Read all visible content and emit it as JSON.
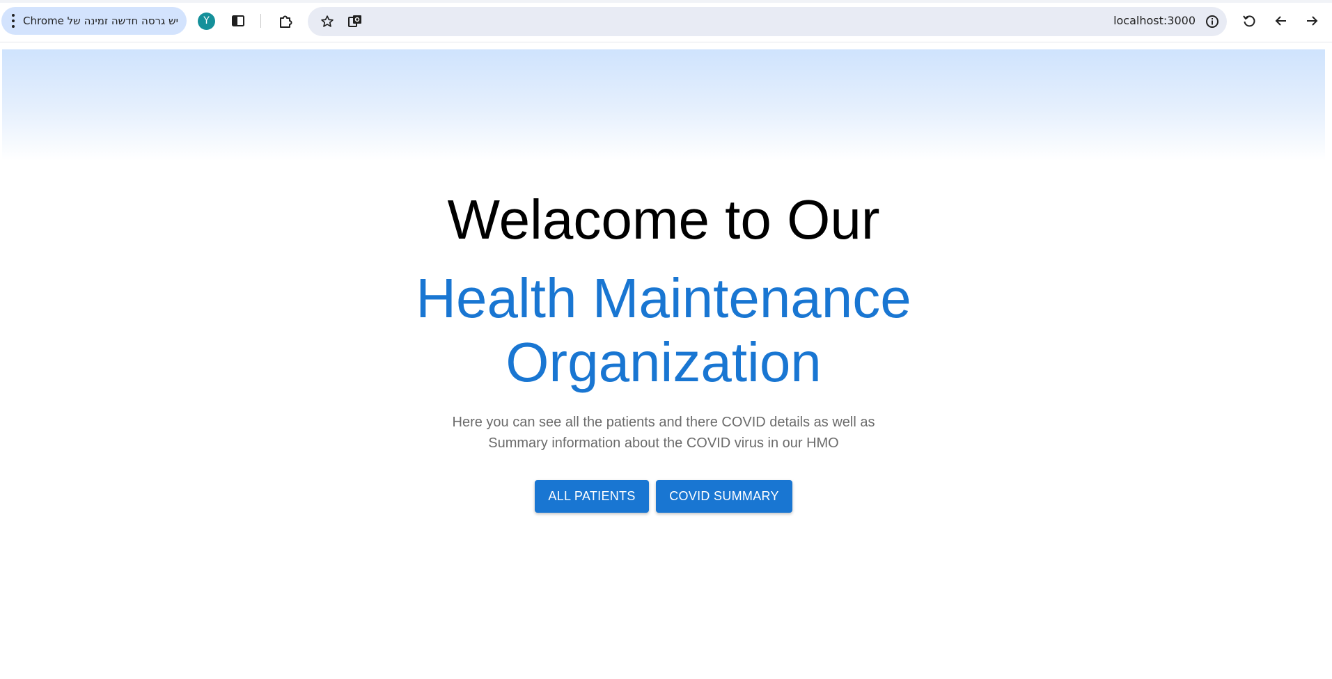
{
  "browser": {
    "update_chip_label": "יש גרסה חדשה זמינה של Chrome",
    "avatar_initial": "Y",
    "url": "localhost:3000",
    "icons": {
      "menu": "more-vert-icon",
      "side_panel": "side-panel-icon",
      "extensions": "puzzle-icon",
      "bookmark": "star-icon",
      "translate": "translate-icon",
      "site_info": "info-icon",
      "reload": "reload-icon",
      "back": "arrow-left-icon",
      "forward": "arrow-right-icon"
    },
    "colors": {
      "chip_bg": "#d3e3fd",
      "avatar_bg": "#15909a",
      "omnibox_bg": "#e8ebf4"
    }
  },
  "hero": {
    "title_line": "Welacome to Our",
    "org_line1": "Health Maintenance",
    "org_line2": "Organization",
    "description_line1": "Here you can see all the patients and there COVID details as well as",
    "description_line2": "Summary information about the COVID virus in our HMO"
  },
  "actions": {
    "all_patients_label": "ALL PATIENTS",
    "covid_summary_label": "COVID SUMMARY"
  },
  "theme": {
    "primary": "#1976d2",
    "hero_gradient_top": "#cfe3fd"
  }
}
